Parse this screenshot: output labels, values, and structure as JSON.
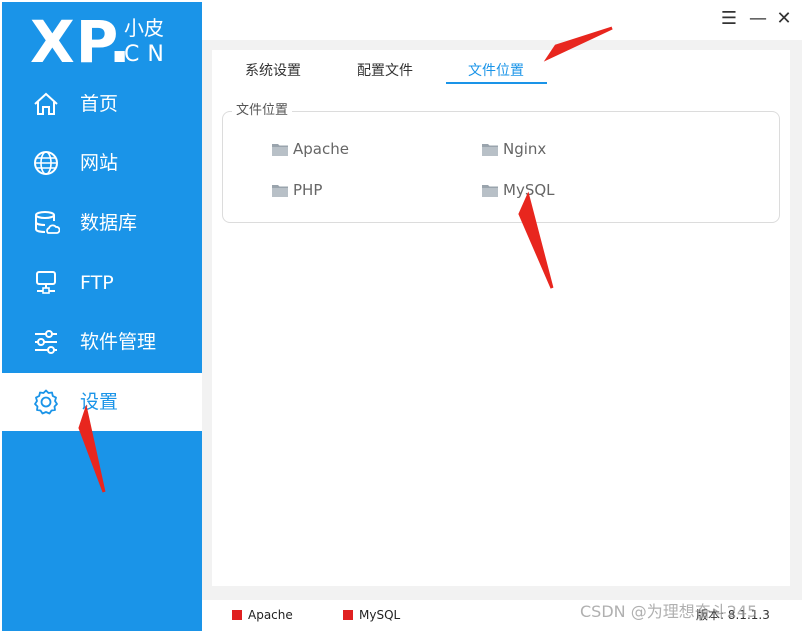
{
  "logo": {
    "brand": "XP.",
    "small": "小皮",
    "cn": "CN"
  },
  "sidebar": {
    "items": [
      {
        "label": "首页",
        "icon": "home-icon"
      },
      {
        "label": "网站",
        "icon": "globe-icon"
      },
      {
        "label": "数据库",
        "icon": "database-icon"
      },
      {
        "label": "FTP",
        "icon": "server-icon"
      },
      {
        "label": "软件管理",
        "icon": "sliders-icon"
      },
      {
        "label": "设置",
        "icon": "gear-icon",
        "active": true
      }
    ]
  },
  "window": {
    "menu": "☰",
    "minimize": "—",
    "close": "✕"
  },
  "tabs": [
    {
      "label": "系统设置"
    },
    {
      "label": "配置文件"
    },
    {
      "label": "文件位置",
      "active": true
    }
  ],
  "file_locations": {
    "title": "文件位置",
    "folders": [
      "Apache",
      "Nginx",
      "PHP",
      "MySQL"
    ]
  },
  "status": {
    "items": [
      {
        "label": "Apache",
        "color": "#e02020"
      },
      {
        "label": "MySQL",
        "color": "#e02020"
      }
    ],
    "version": "版本: 8.1.1.3"
  },
  "watermark": "CSDN @为理想奋斗245",
  "colors": {
    "accent": "#1a94e8",
    "stopped": "#e02020",
    "annotation_arrow": "#e8261e"
  }
}
